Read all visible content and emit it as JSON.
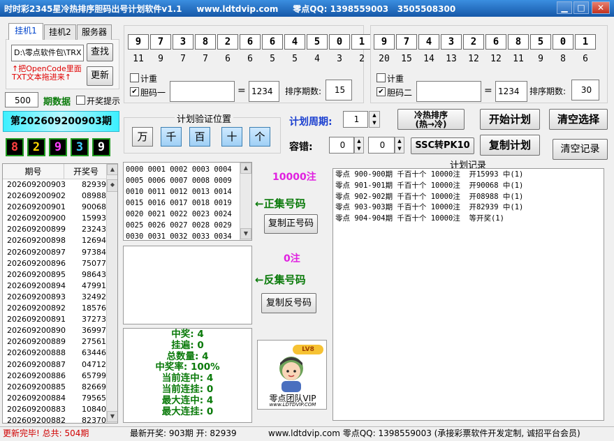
{
  "window": {
    "title": "时时彩2345星冷热排序胆码出号计划软件v1.1     www.ldtdvip.com     零点QQ: 1398559003   3505508300",
    "min": "▁",
    "max": "□",
    "close": "✕"
  },
  "tabs": [
    "挂机1",
    "挂机2",
    "服务器"
  ],
  "left": {
    "path_value": "D:\\零点软件包\\TRX",
    "find_button": "查找",
    "hint_line1": "↑把OpenCode里面",
    "hint_line2": "TXT文本拖进来↑",
    "update_button": "更新",
    "period_count": "500",
    "period_label": "期数据",
    "open_prompt_label": "开奖提示",
    "current_issue": "第202609200903期",
    "balls": [
      {
        "value": "8",
        "color": "#ff4040"
      },
      {
        "value": "2",
        "color": "#ffd700"
      },
      {
        "value": "9",
        "color": "#ff40ff"
      },
      {
        "value": "3",
        "color": "#40d0ff"
      },
      {
        "value": "9",
        "color": "#ffffff"
      }
    ]
  },
  "history": {
    "col_issue": "期号",
    "col_number": "开奖号",
    "rows": [
      [
        "202609200903",
        "82939"
      ],
      [
        "202609200902",
        "08988"
      ],
      [
        "202609200901",
        "90068"
      ],
      [
        "202609200900",
        "15993"
      ],
      [
        "202609200899",
        "23243"
      ],
      [
        "202609200898",
        "12694"
      ],
      [
        "202609200897",
        "97384"
      ],
      [
        "202609200896",
        "75077"
      ],
      [
        "202609200895",
        "98643"
      ],
      [
        "202609200894",
        "47991"
      ],
      [
        "202609200893",
        "32492"
      ],
      [
        "202609200892",
        "18576"
      ],
      [
        "202609200891",
        "37273"
      ],
      [
        "202609200890",
        "36997"
      ],
      [
        "202609200889",
        "27561"
      ],
      [
        "202609200888",
        "63446"
      ],
      [
        "202609200887",
        "04712"
      ],
      [
        "202609200886",
        "65799"
      ],
      [
        "202609200885",
        "82669"
      ],
      [
        "202609200884",
        "79565"
      ],
      [
        "202609200883",
        "10840"
      ],
      [
        "202609200882",
        "82370"
      ]
    ]
  },
  "panel1": {
    "digits": [
      "9",
      "7",
      "3",
      "8",
      "2",
      "6",
      "6",
      "4",
      "5",
      "0",
      "1"
    ],
    "counts": [
      "11",
      "9",
      "7",
      "7",
      "6",
      "6",
      "5",
      "5",
      "4",
      "3",
      "2"
    ],
    "weight_label": "计重",
    "dan_label": "胆码一",
    "dan_value": "",
    "equals": "=",
    "sum_value": "1234",
    "sort_label": "排序期数:",
    "sort_value": "15"
  },
  "panel2": {
    "digits": [
      "9",
      "7",
      "4",
      "3",
      "2",
      "6",
      "8",
      "5",
      "0",
      "1"
    ],
    "counts": [
      "20",
      "15",
      "14",
      "13",
      "12",
      "12",
      "11",
      "9",
      "8",
      "6"
    ],
    "weight_label": "计重",
    "dan_label": "胆码二",
    "dan_value": "",
    "equals": "=",
    "sum_value": "1234",
    "sort_label": "排序期数:",
    "sort_value": "30"
  },
  "verify": {
    "title": "计划验证位置",
    "positions": [
      {
        "label": "万",
        "on": false
      },
      {
        "label": "千",
        "on": true
      },
      {
        "label": "百",
        "on": true
      },
      {
        "label": "十",
        "on": true
      },
      {
        "label": "个",
        "on": true
      }
    ]
  },
  "controls": {
    "cycle_label": "计划周期:",
    "cycle_value": "1",
    "tolerance_label": "容错:",
    "tol_a": "0",
    "tol_b": "0",
    "hot_cold_line1": "冷热排序",
    "hot_cold_line2": "(热→冷)",
    "start_plan": "开始计划",
    "clear_select": "清空选择",
    "ssc_pk10": "SSC转PK10",
    "copy_plan": "复制计划",
    "clear_record": "清空记录"
  },
  "forward": {
    "codes": [
      "0000 0001 0002 0003 0004",
      "0005 0006 0007 0008 0009",
      "0010 0011 0012 0013 0014",
      "0015 0016 0017 0018 0019",
      "0020 0021 0022 0023 0024",
      "0025 0026 0027 0028 0029",
      "0030 0031 0032 0033 0034"
    ],
    "count": "10000注",
    "label": "←正集号码",
    "copy": "复制正号码"
  },
  "reverse": {
    "count": "0注",
    "label": "←反集号码",
    "copy": "复制反号码"
  },
  "stats": [
    "中奖: 4",
    "挂遍: 0",
    "总数量: 4",
    "中奖率: 100%",
    "当前连中: 4",
    "当前连挂: 0",
    "最大连中: 4",
    "最大连挂: 0"
  ],
  "ad": {
    "badge": "LV8",
    "team": "零点团队VIP",
    "site": "www.LDTDVIP.COM"
  },
  "record": {
    "title": "计划记录",
    "lines": [
      "零点 900-900期 千百十个 10000注  开15993 中(1)",
      "零点 901-901期 千百十个 10000注  开90068 中(1)",
      "零点 902-902期 千百十个 10000注  开08988 中(1)",
      "零点 903-903期 千百十个 10000注  开82939 中(1)",
      "零点 904-904期 千百十个 10000注  等开奖(1)"
    ]
  },
  "status": {
    "left": "更新完毕! 总共: 504期",
    "mid": "最新开奖: 903期 开: 82939",
    "right": "www.ldtdvip.com  零点QQ: 1398559003 (承接彩票软件开发定制, 诚招平台会员)"
  }
}
